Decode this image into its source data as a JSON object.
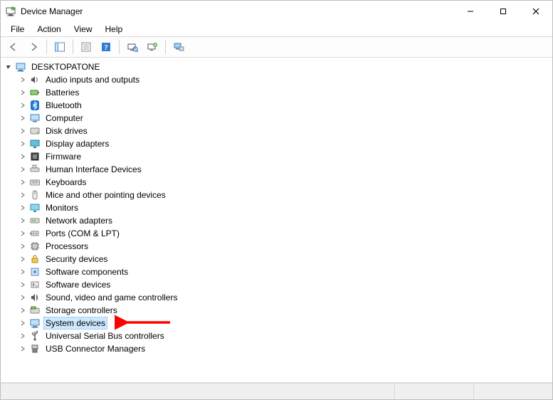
{
  "window": {
    "title": "Device Manager"
  },
  "menu": {
    "file": "File",
    "action": "Action",
    "view": "View",
    "help": "Help"
  },
  "toolbar": {
    "back": "Back",
    "forward": "Forward",
    "show_hide_tree": "Show/Hide Console Tree",
    "properties": "Properties",
    "help": "Help",
    "scan": "Scan for hardware changes",
    "add_legacy": "Add legacy hardware",
    "devices_printers": "Devices and Printers"
  },
  "tree": {
    "root": {
      "label": "DESKTOPATONE",
      "icon": "computer-root-icon"
    },
    "items": [
      {
        "label": "Audio inputs and outputs",
        "icon": "audio-icon"
      },
      {
        "label": "Batteries",
        "icon": "battery-icon"
      },
      {
        "label": "Bluetooth",
        "icon": "bluetooth-icon"
      },
      {
        "label": "Computer",
        "icon": "computer-icon"
      },
      {
        "label": "Disk drives",
        "icon": "disk-icon"
      },
      {
        "label": "Display adapters",
        "icon": "display-icon"
      },
      {
        "label": "Firmware",
        "icon": "firmware-icon"
      },
      {
        "label": "Human Interface Devices",
        "icon": "hid-icon"
      },
      {
        "label": "Keyboards",
        "icon": "keyboard-icon"
      },
      {
        "label": "Mice and other pointing devices",
        "icon": "mouse-icon"
      },
      {
        "label": "Monitors",
        "icon": "monitor-icon"
      },
      {
        "label": "Network adapters",
        "icon": "network-icon"
      },
      {
        "label": "Ports (COM & LPT)",
        "icon": "port-icon"
      },
      {
        "label": "Processors",
        "icon": "cpu-icon"
      },
      {
        "label": "Security devices",
        "icon": "security-icon"
      },
      {
        "label": "Software components",
        "icon": "software-component-icon"
      },
      {
        "label": "Software devices",
        "icon": "software-device-icon"
      },
      {
        "label": "Sound, video and game controllers",
        "icon": "sound-icon"
      },
      {
        "label": "Storage controllers",
        "icon": "storage-icon"
      },
      {
        "label": "System devices",
        "icon": "system-device-icon",
        "selected": true
      },
      {
        "label": "Universal Serial Bus controllers",
        "icon": "usb-icon"
      },
      {
        "label": "USB Connector Managers",
        "icon": "usb-connector-icon"
      }
    ]
  },
  "annotation": {
    "arrow_color": "#ff0000"
  }
}
